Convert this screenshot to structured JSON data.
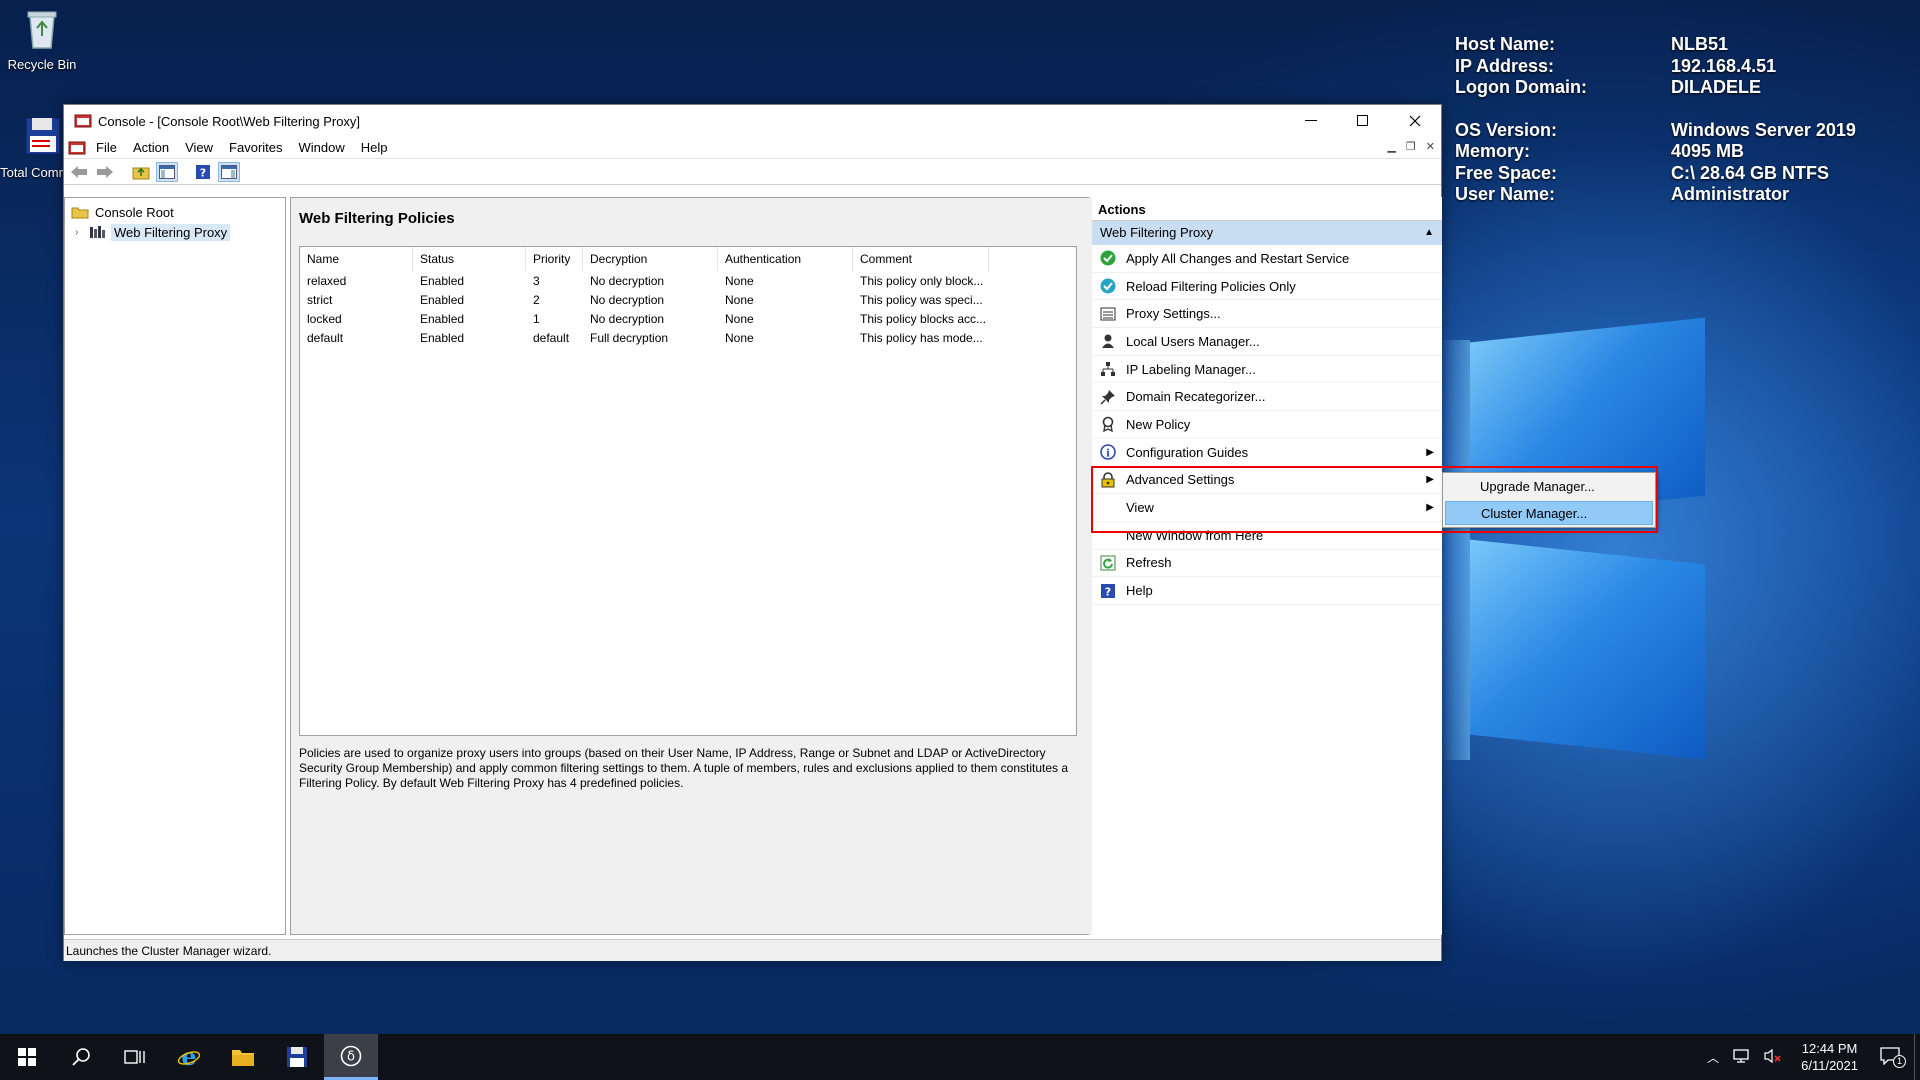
{
  "desktop": {
    "icons": [
      {
        "label": "Recycle Bin"
      },
      {
        "label": "Total Comman"
      }
    ],
    "sysinfo": [
      {
        "key": "Host Name:",
        "value": "NLB51"
      },
      {
        "key": "IP Address:",
        "value": "192.168.4.51"
      },
      {
        "key": "Logon Domain:",
        "value": "DILADELE"
      },
      {
        "key": "OS Version:",
        "value": "Windows Server 2019"
      },
      {
        "key": "Memory:",
        "value": "4095 MB"
      },
      {
        "key": "Free Space:",
        "value": "C:\\ 28.64 GB NTFS"
      },
      {
        "key": "User Name:",
        "value": "Administrator"
      }
    ]
  },
  "window": {
    "title": "Console - [Console Root\\Web Filtering Proxy]",
    "menu": [
      "File",
      "Action",
      "View",
      "Favorites",
      "Window",
      "Help"
    ],
    "tree": {
      "root": "Console Root",
      "child": "Web Filtering Proxy"
    },
    "center": {
      "heading": "Web Filtering Policies",
      "columns": [
        "Name",
        "Status",
        "Priority",
        "Decryption",
        "Authentication",
        "Comment"
      ],
      "rows": [
        [
          "relaxed",
          "Enabled",
          "3",
          "No decryption",
          "None",
          "This policy only block..."
        ],
        [
          "strict",
          "Enabled",
          "2",
          "No decryption",
          "None",
          "This policy was speci..."
        ],
        [
          "locked",
          "Enabled",
          "1",
          "No decryption",
          "None",
          "This policy blocks acc..."
        ],
        [
          "default",
          "Enabled",
          "default",
          "Full decryption",
          "None",
          "This policy has mode..."
        ]
      ],
      "description": "Policies are used to organize proxy users into groups (based on their User Name, IP Address, Range or Subnet and LDAP or ActiveDirectory Security Group Membership) and apply common filtering settings to them. A tuple of members, rules and exclusions applied to them constitutes a Filtering Policy. By default Web Filtering Proxy has 4 predefined policies."
    },
    "actions": {
      "header": "Actions",
      "section": "Web Filtering Proxy",
      "items": [
        {
          "label": "Apply All Changes and Restart Service",
          "icon": "check-circle-icon"
        },
        {
          "label": "Reload Filtering Policies Only",
          "icon": "reload-icon"
        },
        {
          "label": "Proxy Settings...",
          "icon": "settings-list-icon"
        },
        {
          "label": "Local Users Manager...",
          "icon": "user-icon"
        },
        {
          "label": "IP Labeling Manager...",
          "icon": "network-icon"
        },
        {
          "label": "Domain Recategorizer...",
          "icon": "pin-icon"
        },
        {
          "label": "New Policy",
          "icon": "award-icon"
        },
        {
          "label": "Configuration Guides",
          "icon": "info-icon"
        },
        {
          "label": "Advanced Settings",
          "icon": "lock-icon"
        },
        {
          "label": "View",
          "icon": ""
        },
        {
          "label": "New Window from Here",
          "icon": ""
        },
        {
          "label": "Refresh",
          "icon": "refresh-icon"
        },
        {
          "label": "Help",
          "icon": "help-icon"
        }
      ]
    },
    "submenu": [
      "Upgrade Manager...",
      "Cluster Manager..."
    ],
    "status": "Launches the Cluster Manager wizard."
  },
  "taskbar": {
    "time": "12:44 PM",
    "date": "6/11/2021",
    "notifications": "1"
  }
}
